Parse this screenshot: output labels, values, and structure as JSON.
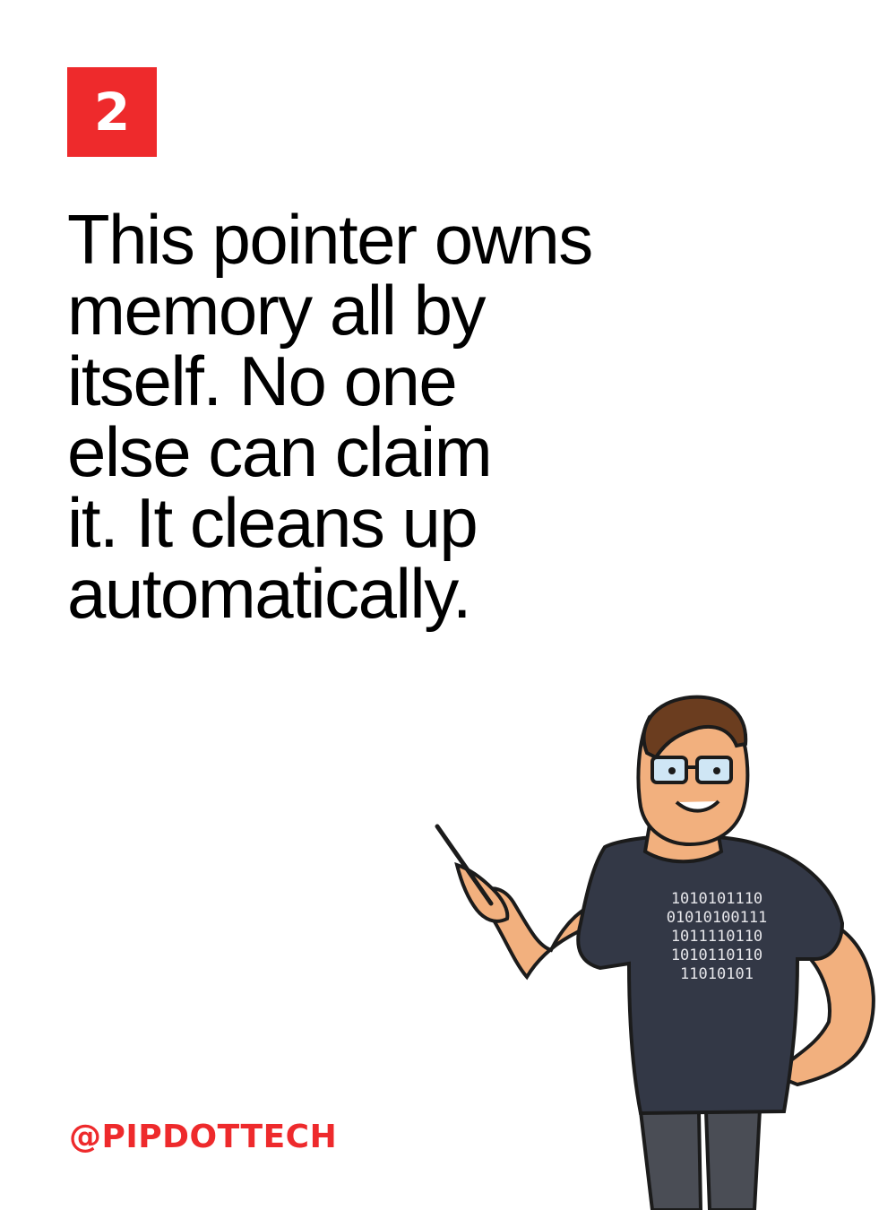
{
  "slide": {
    "number": "2",
    "headline_lines": [
      "This pointer owns",
      "memory all by",
      "itself. No one",
      "else can claim",
      "it. It cleans up",
      "automatically."
    ],
    "handle": "@PIPDOTTECH"
  },
  "mascot": {
    "icon": "muscular-programmer-pointing-icon",
    "shirt_binary": [
      "1010101110",
      "01010100111",
      "1011110110",
      "1010110110",
      "11010101"
    ]
  },
  "colors": {
    "accent": "#ee2a2c",
    "text": "#000000",
    "background": "#ffffff",
    "shirt": "#333846",
    "skin": "#f2b07e",
    "hair": "#6b3d1f",
    "pants": "#4a4d55"
  }
}
